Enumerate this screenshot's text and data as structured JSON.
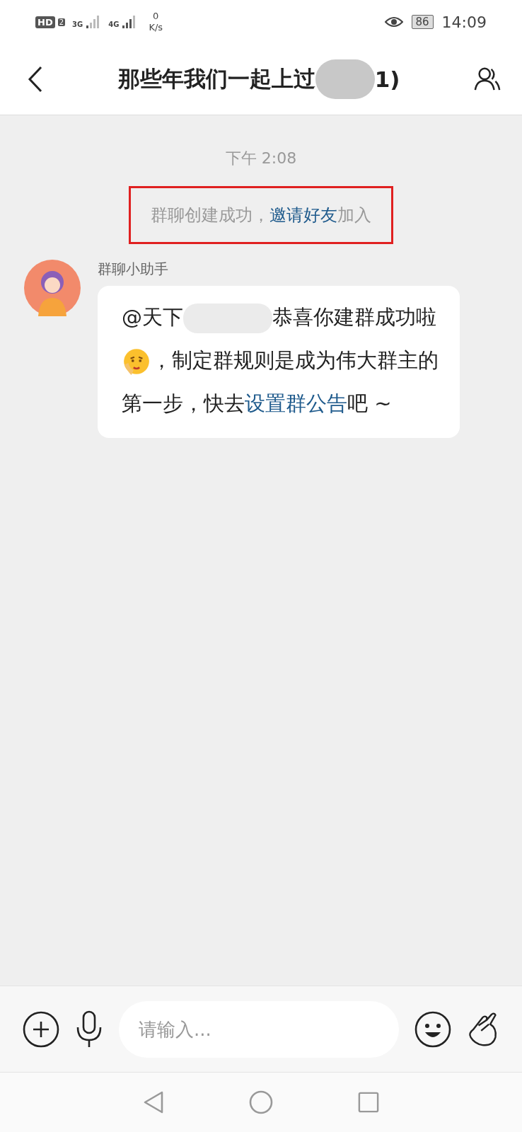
{
  "status_bar": {
    "hd": "HD",
    "sim": "2",
    "net_3g": "3G",
    "net_4g": "4G",
    "speed_value": "0",
    "speed_unit": "K/s",
    "battery": "86",
    "time": "14:09"
  },
  "header": {
    "title_start": "那些年我们一起上过",
    "title_end": "1)"
  },
  "messages": [
    {
      "kind": "time",
      "text": "下午 2:08"
    },
    {
      "kind": "system",
      "text": "群聊创建成功，",
      "link": "邀请好友",
      "tail": "加入",
      "highlighted": true
    },
    {
      "kind": "bubble",
      "sender": "群聊小助手",
      "mention": "@天下",
      "text": "恭喜你建群成功啦",
      "after_emoji": "，制定群规则是成为伟大群主的第一步，快去",
      "link": "设置群公告",
      "tail": "吧 ~"
    }
  ],
  "input": {
    "placeholder": "请输入..."
  }
}
